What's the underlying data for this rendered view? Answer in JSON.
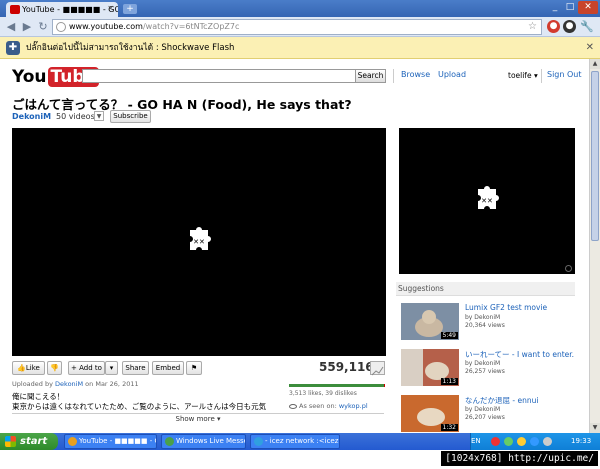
{
  "browser": {
    "tab_title": "YouTube - ■■■■■ - GO HA N...",
    "url_main": "www.youtube.com",
    "url_rest": "/watch?v=6tNTcZOpZ7c",
    "min_label": "_",
    "max_label": "□",
    "close_label": "✕",
    "new_tab_label": "+"
  },
  "infobar": {
    "message": "ปลั๊กอินต่อไปนี้ไม่สามารถใช้งานได้ : Shockwave Flash"
  },
  "header": {
    "logo_you": "You",
    "logo_tube": "Tube",
    "search_label": "Search",
    "browse": "Browse",
    "upload": "Upload",
    "user": "toelife",
    "user_caret": "▾",
    "sign_out": "Sign Out"
  },
  "video": {
    "title": "ごはんて言ってる？ - GO HA N (Food), He says that?",
    "channel": "DekoniM",
    "video_count": "50 videos",
    "subscribe": "Subscribe",
    "views": "559,116",
    "like": "Like",
    "add_to": "+ Add to",
    "share": "Share",
    "embed": "Embed",
    "uploaded_prefix": "Uploaded by",
    "uploaded_by": "DekoniM",
    "uploaded_on": "on Mar 26, 2011",
    "likes_text": "3,513 likes, 39 dislikes",
    "like_ratio": 0.989,
    "seen_on_prefix": "As seen on:",
    "seen_on_site": "wykop.pl",
    "desc_line1": "俺に聞こえる！",
    "desc_line2": "東京からは遠くはなれていたため、ご覧のように、アールさんは今日も元気",
    "show_more": "Show more ▾"
  },
  "suggestions": {
    "heading": "Suggestions",
    "items": [
      {
        "title": "Lumix GF2 test movie",
        "by": "by DekoniM",
        "views": "20,364 views",
        "duration": "5:49",
        "color": "#7d8fa4"
      },
      {
        "title": "いーれーてー - I want to enter.",
        "by": "by DekoniM",
        "views": "26,257 views",
        "duration": "1:13",
        "color": "#b5604a"
      },
      {
        "title": "なんだか退屈 - ennui",
        "by": "by DekoniM",
        "views": "26,207 views",
        "duration": "1:32",
        "color": "#c9692e"
      }
    ]
  },
  "taskbar": {
    "start": "start",
    "tasks": [
      {
        "label": "YouTube - ■■■■■ - GO...",
        "color": "#e8a020"
      },
      {
        "label": "Windows Live Messen...",
        "color": "#4aa04a"
      },
      {
        "label": "- icez network :<icez...",
        "color": "#30a0e0"
      }
    ],
    "lang": "EN",
    "clock": "19:33"
  },
  "caption": "[1024x768] http://upic.me/"
}
